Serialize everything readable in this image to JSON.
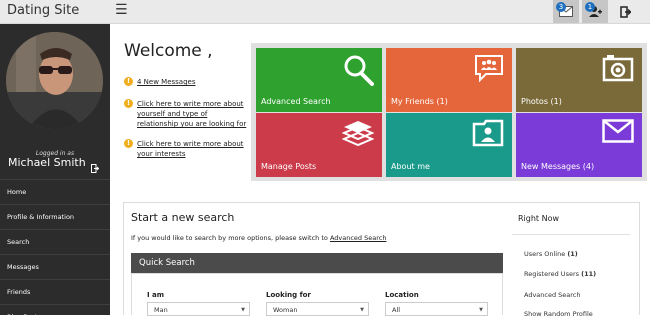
{
  "app": {
    "title": "Dating Site",
    "menu_icon": "hamburger-icon"
  },
  "topbar": {
    "messages": {
      "icon": "envelope-icon",
      "badge": "3"
    },
    "friend_requests": {
      "icon": "add-user-icon",
      "badge": "1"
    },
    "logout": {
      "icon": "logout-icon"
    }
  },
  "user": {
    "logged_in_as": "Logged in as",
    "name": "Michael Smith",
    "logout_icon": "logout-icon"
  },
  "sidebar": {
    "items": [
      {
        "label": "Home"
      },
      {
        "label": "Profile & Information"
      },
      {
        "label": "Search"
      },
      {
        "label": "Messages"
      },
      {
        "label": "Friends"
      },
      {
        "label": "Blog Posts"
      }
    ]
  },
  "welcome": {
    "title": "Welcome ,",
    "notices": [
      {
        "text": "4 New Messages"
      },
      {
        "text": "Click here to write more about yourself and type of relationship you are looking for"
      },
      {
        "text": "Click here to write more about your interests"
      }
    ]
  },
  "tiles": [
    {
      "label": "Advanced Search",
      "icon": "search-icon",
      "color": "#2ea12e"
    },
    {
      "label": "My Friends (1)",
      "icon": "group-icon",
      "color": "#e5663a"
    },
    {
      "label": "Photos (1)",
      "icon": "camera-icon",
      "color": "#7a6a3a"
    },
    {
      "label": "Manage Posts",
      "icon": "stack-icon",
      "color": "#cc3b4a"
    },
    {
      "label": "About me",
      "icon": "profile-card-icon",
      "color": "#1a9a8a"
    },
    {
      "label": "New Messages (4)",
      "icon": "envelope-icon",
      "color": "#7a3bd8"
    }
  ],
  "search": {
    "title": "Start a new search",
    "subtitle": "If you would like to search by more options, please switch to",
    "advanced_link": "Advanced Search",
    "quick_search": "Quick Search",
    "fields": [
      {
        "label": "I am",
        "value": "Man"
      },
      {
        "label": "Looking for",
        "value": "Woman"
      },
      {
        "label": "Location",
        "value": "All"
      }
    ]
  },
  "right_now": {
    "title": "Right Now",
    "users_online": {
      "label": "Users Online",
      "count": "(1)"
    },
    "registered_users": {
      "label": "Registered Users",
      "count": "(11)"
    },
    "advanced_search": "Advanced Search",
    "show_random": "Show Random Profile"
  }
}
